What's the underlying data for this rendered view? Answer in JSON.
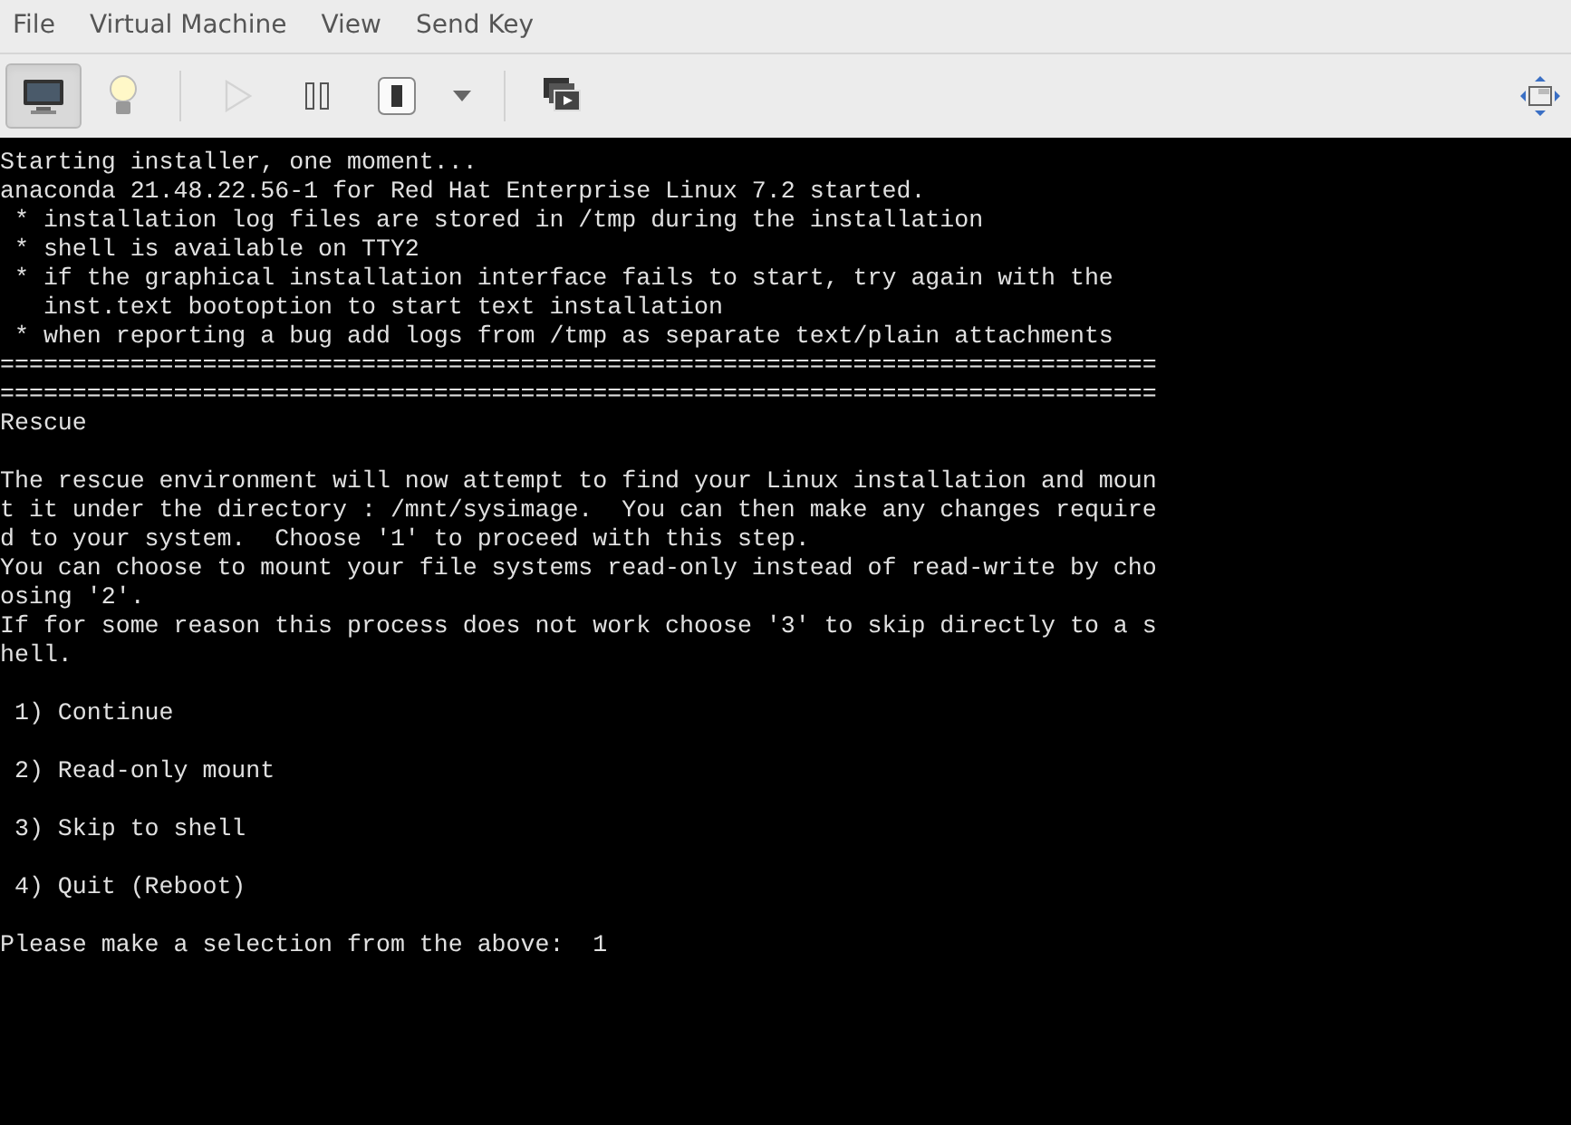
{
  "menu_bar": [
    "File",
    "Virtual Machine",
    "View",
    "Send Key"
  ],
  "toolbar": {
    "buttons": [
      {
        "kind": "console",
        "selected": true,
        "disabled": false
      },
      {
        "kind": "details",
        "selected": false,
        "disabled": false
      },
      {
        "kind": "separator"
      },
      {
        "kind": "run",
        "selected": false,
        "disabled": true
      },
      {
        "kind": "pause",
        "selected": false,
        "disabled": false
      },
      {
        "kind": "shutdown",
        "selected": false,
        "disabled": false
      },
      {
        "kind": "dropdown",
        "selected": false,
        "disabled": false
      },
      {
        "kind": "separator"
      },
      {
        "kind": "snapshots",
        "selected": false,
        "disabled": false
      }
    ],
    "right_button": {
      "kind": "resize"
    }
  },
  "console": {
    "blocks": [
      [
        "Starting installer, one moment...",
        "anaconda 21.48.22.56-1 for Red Hat Enterprise Linux 7.2 started.",
        " * installation log files are stored in /tmp during the installation",
        " * shell is available on TTY2",
        " * if the graphical installation interface fails to start, try again with the",
        "   inst.text bootoption to start text installation",
        " * when reporting a bug add logs from /tmp as separate text/plain attachments",
        "================================================================================",
        "================================================================================",
        "Rescue"
      ],
      [
        "The rescue environment will now attempt to find your Linux installation and moun",
        "t it under the directory : /mnt/sysimage.  You can then make any changes require",
        "d to your system.  Choose '1' to proceed with this step.",
        "You can choose to mount your file systems read-only instead of read-write by cho",
        "osing '2'.",
        "If for some reason this process does not work choose '3' to skip directly to a s",
        "hell."
      ],
      [
        " 1) Continue"
      ],
      [
        " 2) Read-only mount"
      ],
      [
        " 3) Skip to shell"
      ],
      [
        " 4) Quit (Reboot)"
      ],
      [
        "Please make a selection from the above:  1"
      ]
    ]
  }
}
